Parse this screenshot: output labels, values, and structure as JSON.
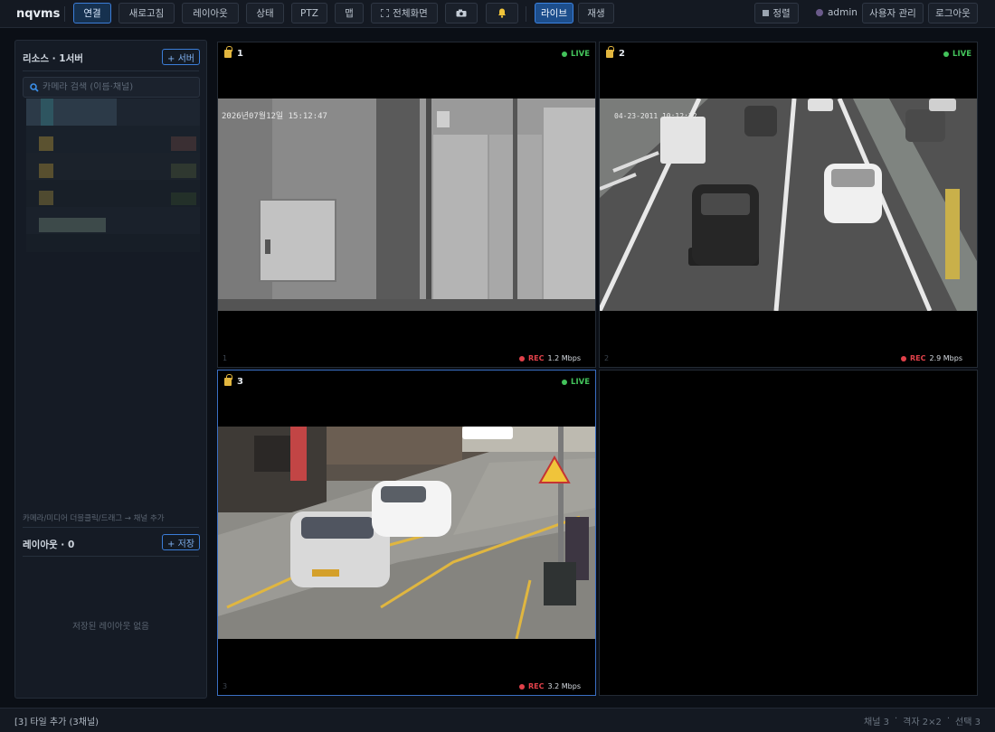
{
  "app": {
    "title": "nqvms"
  },
  "toolbar": {
    "connect": "연결",
    "refresh": "새로고침",
    "layout": "레이아웃",
    "status": "상태",
    "ptz": "PTZ",
    "map": "맵",
    "fullscreen": "전체화면",
    "live": "라이브",
    "playback": "재생",
    "sort": "정렬",
    "user_name": "admin",
    "user_manage": "사용자 관리",
    "logout": "로그아웃"
  },
  "sidebar": {
    "resources_title": "리소스 · 1서버",
    "add_server": "+ 서버",
    "search_placeholder": "카메라 검색 (이름·채널)",
    "hint": "카메라/미디어 더블클릭/드래그 → 채널 추가",
    "layouts_title": "레이아웃 · 0",
    "save_layout": "+ 저장",
    "empty_layouts": "저장된 레이아웃 없음"
  },
  "tiles": [
    {
      "name": "1",
      "status": "LIVE",
      "index": "1",
      "rec_label": "REC",
      "bitrate": "1.2 Mbps",
      "overlay_text": "2026년07월12일 15:12:47"
    },
    {
      "name": "2",
      "status": "LIVE",
      "index": "2",
      "rec_label": "REC",
      "bitrate": "2.9 Mbps",
      "overlay_text": "04-23-2011 10:12:32"
    },
    {
      "name": "3",
      "status": "LIVE",
      "index": "3",
      "rec_label": "REC",
      "bitrate": "3.2 Mbps",
      "overlay_text": ""
    }
  ],
  "statusbar": {
    "message": "[3] 타일 추가 (3채널)",
    "channels": "채널 3",
    "sep1": "·",
    "grid": "격자 2×2",
    "sep2": "·",
    "selected": "선택 3"
  },
  "colors": {
    "accent": "#3b7dd8",
    "live": "#43c35b",
    "rec": "#e2414a",
    "lock": "#e2b63f"
  }
}
